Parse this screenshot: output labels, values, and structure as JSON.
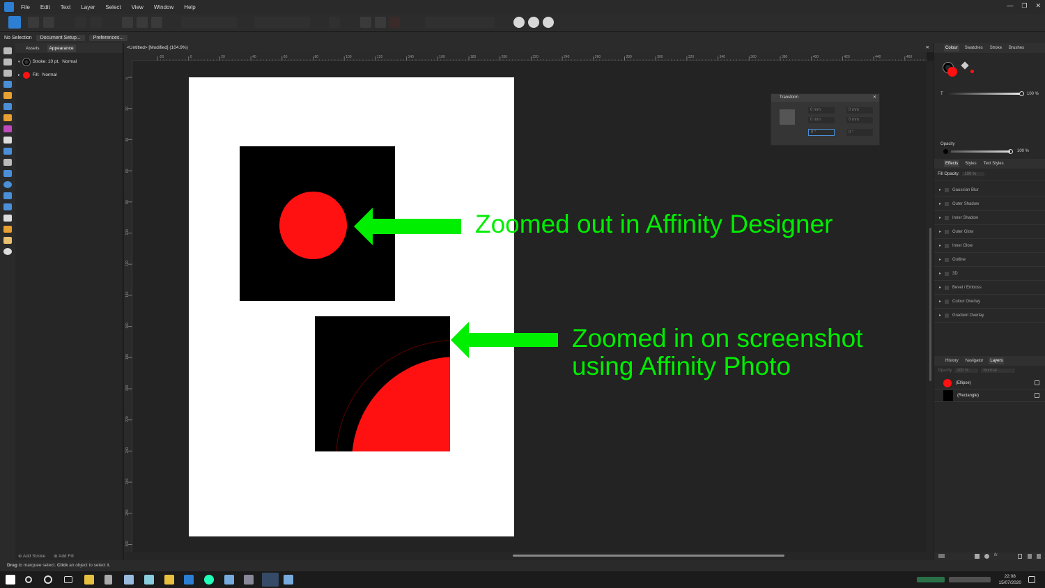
{
  "menu": [
    "File",
    "Edit",
    "Text",
    "Layer",
    "Select",
    "View",
    "Window",
    "Help"
  ],
  "window_controls": [
    "—",
    "❐",
    "✕"
  ],
  "context_bar": {
    "selection": "No Selection",
    "doc_setup": "Document Setup...",
    "preferences": "Preferences..."
  },
  "left_panel": {
    "tabs": [
      "Assets",
      "Appearance"
    ],
    "active_tab": "Appearance",
    "stroke_label": "Stroke: 10 pt,",
    "stroke_mode": "Normal",
    "fill_label": "Fill:",
    "fill_mode": "Normal",
    "add_stroke": "Add Stroke",
    "add_fill": "Add Fill"
  },
  "document": {
    "tab_title": "<Untitled> [Modified] (104.9%)",
    "h_ticks": [
      "-20",
      "0",
      "20",
      "40",
      "60",
      "80",
      "100",
      "120",
      "140",
      "160",
      "180",
      "200",
      "220",
      "240",
      "260",
      "280",
      "300",
      "320",
      "340",
      "360",
      "380",
      "400",
      "420",
      "440",
      "460"
    ],
    "v_ticks": [
      "0",
      "20",
      "40",
      "60",
      "80",
      "100",
      "120",
      "140",
      "160",
      "180",
      "200",
      "220",
      "240",
      "260",
      "280",
      "300"
    ]
  },
  "annotations": {
    "line1": "Zoomed out in Affinity Designer",
    "line2a": "Zoomed in on screenshot",
    "line2b": "using Affinity Photo"
  },
  "transform_panel": {
    "title": "Transform",
    "x": "0 mm",
    "w": "0 mm",
    "y": "0 mm",
    "h": "0 mm",
    "r": "0 °",
    "s": "0 °"
  },
  "colour_panel": {
    "tabs": [
      "Colour",
      "Swatches",
      "Stroke",
      "Brushes"
    ],
    "active_tab": "Colour",
    "t_label": "T",
    "t_value": "100 %",
    "opacity_label": "Opacity",
    "opacity_value": "100 %"
  },
  "effects_panel": {
    "tabs": [
      "Effects",
      "Styles",
      "Text Styles"
    ],
    "active_tab": "Effects",
    "fill_opacity_label": "Fill Opacity:",
    "fill_opacity_value": "100 %",
    "effects": [
      "Gaussian Blur",
      "Outer Shadow",
      "Inner Shadow",
      "Outer Glow",
      "Inner Glow",
      "Outline",
      "3D",
      "Bevel / Emboss",
      "Colour Overlay",
      "Gradient Overlay"
    ]
  },
  "layers_panel": {
    "tabs": [
      "History",
      "Navigator",
      "Layers"
    ],
    "active_tab": "Layers",
    "opacity_label": "Opacity",
    "opacity_value": "100 %",
    "blend_mode": "Normal",
    "layers": [
      {
        "name": "(Ellipse)",
        "color": "#ff1111"
      },
      {
        "name": "(Rectangle)",
        "color": "#000000"
      }
    ]
  },
  "status": {
    "bold1": "Drag",
    "text1": " to marquee select. ",
    "bold2": "Click",
    "text2": " an object to select it."
  },
  "clock": {
    "time": "22:08",
    "date": "15/07/2020"
  },
  "colors": {
    "accent_green": "#00ee00",
    "shape_red": "#ff1111",
    "app_blue": "#2d7fd3"
  }
}
